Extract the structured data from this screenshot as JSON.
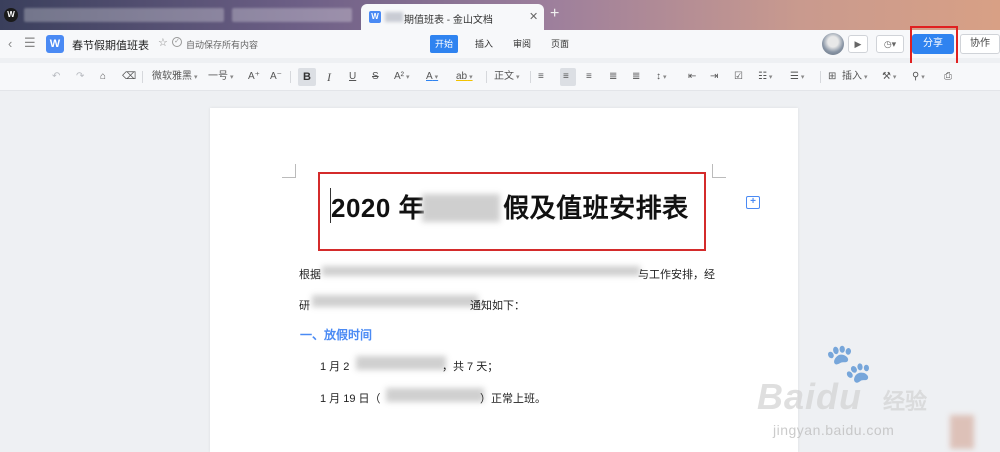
{
  "tabbar": {
    "active_tab_title": "期值班表 - 金山文档",
    "close_glyph": "✕",
    "new_tab_glyph": "+"
  },
  "header": {
    "back_glyph": "‹",
    "menu_glyph": "☰",
    "doc_icon_letter": "W",
    "doc_title": "春节假期值班表",
    "star_glyph": "☆",
    "autosave": "自动保存所有内容",
    "menu_tabs": [
      "开始",
      "插入",
      "审阅",
      "页面"
    ],
    "active_menu": "开始",
    "share_label": "分享",
    "collab_label": "协作"
  },
  "toolbar": {
    "font_name": "微软雅黑",
    "font_size": "一号",
    "bold": "B",
    "italic": "I",
    "underline": "U",
    "strike": "S",
    "style": "正文",
    "insert": "插入"
  },
  "document": {
    "heading_prefix": "2020 年",
    "heading_suffix": "假及值班安排表",
    "para1_start": "根据",
    "para1_end": "与工作安排，经",
    "para2_start": "研",
    "para2_end": "通知如下：",
    "section1": "一、放假时间",
    "item1_start": "1 月 2",
    "item1_end": "，共 7 天；",
    "item2_start": "1 月 19 日（",
    "item2_end": "）正常上班。"
  },
  "watermark": {
    "brand": "Baidu",
    "jingyan": "经验",
    "url": "jingyan.baidu.com"
  },
  "colors": {
    "accent": "#2f83f0",
    "highlight_box": "#d42b2b",
    "section_heading": "#4a8af4"
  }
}
